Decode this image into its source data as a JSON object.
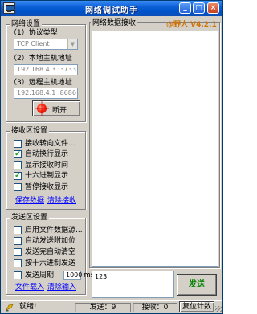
{
  "window": {
    "title": "网络调试助手",
    "minimize_glyph": "_",
    "maximize_glyph": "□",
    "close_glyph": "×"
  },
  "brand": "@野人 V4.2.1",
  "settings": {
    "title": "网络设置",
    "protocol_label": "（1）协议类型",
    "protocol_value": "TCP Client",
    "local_host_label": "（2）本地主机地址",
    "local_host_value": "192.168.4.3 :3733",
    "remote_host_label": "（3）远程主机地址",
    "remote_host_value": "192.168.4.1 :8686",
    "disconnect_label": "断开"
  },
  "receive_settings": {
    "title": "接收区设置",
    "options": [
      {
        "label": "接收转向文件...",
        "checked": false
      },
      {
        "label": "自动换行显示",
        "checked": true
      },
      {
        "label": "显示接收时间",
        "checked": false
      },
      {
        "label": "十六进制显示",
        "checked": true
      },
      {
        "label": "暂停接收显示",
        "checked": false
      }
    ],
    "save_data": "保存数据",
    "clear_receive": "清除接收"
  },
  "send_settings": {
    "title": "发送区设置",
    "options": [
      {
        "label": "启用文件数据源...",
        "checked": false
      },
      {
        "label": "自动发送附加位",
        "checked": false
      },
      {
        "label": "发送完自动清空",
        "checked": false
      },
      {
        "label": "按十六进制发送",
        "checked": false
      },
      {
        "label": "发送周期",
        "checked": false
      }
    ],
    "period_value": "1000",
    "period_unit": "ms",
    "file_load": "文件载入",
    "clear_input": "清除输入"
  },
  "receive_area": {
    "title": "网络数据接收",
    "content": ""
  },
  "send_area": {
    "content": "123",
    "send_button": "发送"
  },
  "status": {
    "ready": "就绪!",
    "sent_label": "发送：9",
    "received_label": "接收：0",
    "reset_button": "复位计数"
  },
  "colors": {
    "brand": "#d07000",
    "send_button_text": "#008000",
    "link": "#0000ff",
    "check": "#21a121"
  }
}
